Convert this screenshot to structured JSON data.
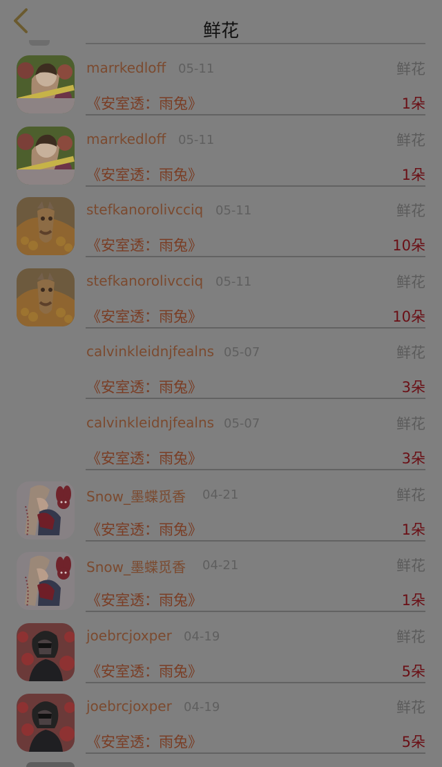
{
  "page": {
    "title": "鲜花",
    "back_icon": "chevron-left-icon"
  },
  "items": [
    {
      "name": "marrkedloff",
      "date": "05-11",
      "type": "鲜花",
      "work": "《安室透：雨兔》",
      "count": "1朵",
      "avatar": "photo-girl-flowers"
    },
    {
      "name": "marrkedloff",
      "date": "05-11",
      "type": "鲜花",
      "work": "《安室透：雨兔》",
      "count": "1朵",
      "avatar": "photo-girl-flowers"
    },
    {
      "name": "stefkanorolivcciq",
      "date": "05-11",
      "type": "鲜花",
      "work": "《安室透：雨兔》",
      "count": "10朵",
      "avatar": "photo-giraffe-hay"
    },
    {
      "name": "stefkanorolivcciq",
      "date": "05-11",
      "type": "鲜花",
      "work": "《安室透：雨兔》",
      "count": "10朵",
      "avatar": "photo-giraffe-hay"
    },
    {
      "name": "calvinkleidnjfealns",
      "date": "05-07",
      "type": "鲜花",
      "work": "《安室透：雨兔》",
      "count": "3朵",
      "avatar": ""
    },
    {
      "name": "calvinkleidnjfealns",
      "date": "05-07",
      "type": "鲜花",
      "work": "《安室透：雨兔》",
      "count": "3朵",
      "avatar": ""
    },
    {
      "name": "Snow_墨蝶觅香",
      "date": "04-21",
      "type": "鲜花",
      "work": "《安室透：雨兔》",
      "count": "1朵",
      "avatar": "anime-girl-bunny"
    },
    {
      "name": "Snow_墨蝶觅香",
      "date": "04-21",
      "type": "鲜花",
      "work": "《安室透：雨兔》",
      "count": "1朵",
      "avatar": "anime-girl-bunny"
    },
    {
      "name": "joebrcjoxper",
      "date": "04-19",
      "type": "鲜花",
      "work": "《安室透：雨兔》",
      "count": "5朵",
      "avatar": "photo-dark-person-red"
    },
    {
      "name": "joebrcjoxper",
      "date": "04-19",
      "type": "鲜花",
      "work": "《安室透：雨兔》",
      "count": "5朵",
      "avatar": "photo-dark-person-red"
    }
  ],
  "colors": {
    "overlay": "#7f7f7f",
    "name": "#7b4a2f",
    "work": "#7a3d24",
    "count": "#6a0f15"
  }
}
